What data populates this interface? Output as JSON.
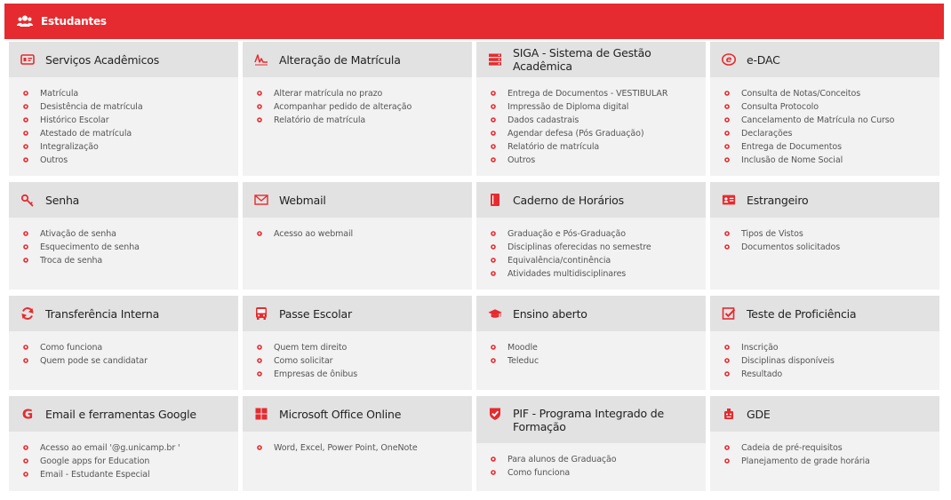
{
  "header": {
    "title": "Estudantes",
    "icon": "users-icon"
  },
  "colors": {
    "accent": "#e52b2f",
    "card_bg": "#f2f2f2",
    "card_head_bg": "#e2e2e2"
  },
  "cards": [
    {
      "title": "Serviços Acadêmicos",
      "icon": "id-card-icon",
      "items": [
        "Matrícula",
        "Desistência de matrícula",
        "Histórico Escolar",
        "Atestado de matrícula",
        "Integralização",
        "Outros"
      ]
    },
    {
      "title": "Alteração de Matrícula",
      "icon": "signature-icon",
      "items": [
        "Alterar matrícula no prazo",
        "Acompanhar pedido de alteração",
        "Relatório de matrícula"
      ]
    },
    {
      "title": "SIGA - Sistema de Gestão Acadêmica",
      "icon": "server-icon",
      "items": [
        "Entrega de Documentos - VESTIBULAR",
        "Impressão de Diploma digital",
        "Dados cadastrais",
        "Agendar defesa (Pós Graduação)",
        "Relatório de matrícula",
        "Outros"
      ]
    },
    {
      "title": "e-DAC",
      "icon": "edac-logo-icon",
      "items": [
        "Consulta de Notas/Conceitos",
        "Consulta Protocolo",
        "Cancelamento de Matrícula no Curso",
        "Declarações",
        "Entrega de Documentos",
        "Inclusão de Nome Social"
      ]
    },
    {
      "title": "Senha",
      "icon": "key-icon",
      "items": [
        "Ativação de senha",
        "Esquecimento de senha",
        "Troca de senha"
      ]
    },
    {
      "title": "Webmail",
      "icon": "envelope-icon",
      "items": [
        "Acesso ao webmail"
      ]
    },
    {
      "title": "Caderno de Horários",
      "icon": "book-icon",
      "items": [
        "Graduação e Pós-Graduação",
        "Disciplinas oferecidas no semestre",
        "Equivalência/continência",
        "Atividades multidisciplinares"
      ]
    },
    {
      "title": "Estrangeiro",
      "icon": "passport-card-icon",
      "items": [
        "Tipos de Vistos",
        "Documentos solicitados"
      ]
    },
    {
      "title": "Transferência Interna",
      "icon": "refresh-icon",
      "items": [
        "Como funciona",
        "Quem pode se candidatar"
      ]
    },
    {
      "title": "Passe Escolar",
      "icon": "bus-icon",
      "items": [
        "Quem tem direito",
        "Como solicitar",
        "Empresas de ônibus"
      ]
    },
    {
      "title": "Ensino aberto",
      "icon": "graduation-cap-icon",
      "items": [
        "Moodle",
        "Teleduc"
      ]
    },
    {
      "title": "Teste de Proficiência",
      "icon": "checkbox-icon",
      "items": [
        "Inscrição",
        "Disciplinas disponíveis",
        "Resultado"
      ]
    },
    {
      "title": "Email e ferramentas Google",
      "icon": "google-icon",
      "items": [
        "Acesso ao email '@g.unicamp.br '",
        "Google apps for Education",
        "Email - Estudante Especial"
      ]
    },
    {
      "title": "Microsoft Office Online",
      "icon": "windows-icon",
      "items": [
        "Word, Excel, Power Point, OneNote"
      ]
    },
    {
      "title": "PIF - Programa Integrado de Formação",
      "icon": "shield-check-icon",
      "items": [
        "Para alunos de Graduação",
        "Como funciona"
      ]
    },
    {
      "title": "GDE",
      "icon": "robot-icon",
      "items": [
        "Cadeia de pré-requisitos",
        "Planejamento de grade horária"
      ]
    }
  ]
}
